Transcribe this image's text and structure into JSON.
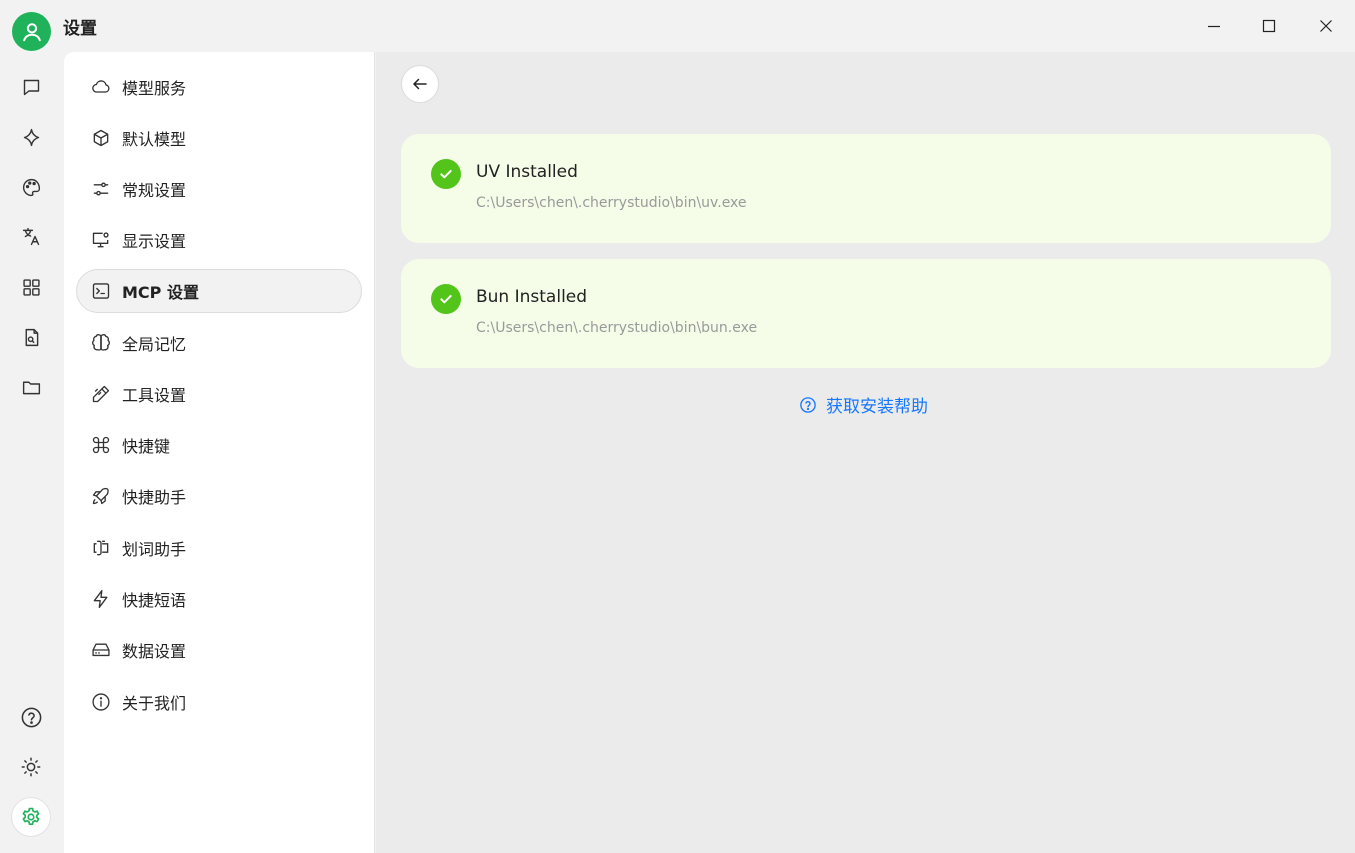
{
  "window": {
    "title": "设置",
    "controls": [
      "minimize-icon",
      "maximize-icon",
      "close-icon"
    ],
    "accent": "#1fb25a"
  },
  "rail": {
    "top": [
      "chat-bubble-icon",
      "sparkle-icon",
      "palette-icon",
      "translate-icon",
      "apps-grid-icon",
      "file-search-icon",
      "folder-icon"
    ],
    "bottom": [
      "help-circle-icon",
      "sun-icon",
      "gear-icon"
    ],
    "active": "gear-icon"
  },
  "menu": {
    "items": [
      {
        "label": "模型服务",
        "icon": "cloud-icon"
      },
      {
        "label": "默认模型",
        "icon": "cube-icon"
      },
      {
        "label": "常规设置",
        "icon": "sliders-icon"
      },
      {
        "label": "显示设置",
        "icon": "monitor-gear-icon"
      },
      {
        "label": "MCP 设置",
        "icon": "terminal-icon"
      },
      {
        "label": "全局记忆",
        "icon": "brain-icon"
      },
      {
        "label": "工具设置",
        "icon": "pencil-ruler-icon"
      },
      {
        "label": "快捷键",
        "icon": "command-icon"
      },
      {
        "label": "快捷助手",
        "icon": "rocket-icon"
      },
      {
        "label": "划词助手",
        "icon": "text-cursor-icon"
      },
      {
        "label": "快捷短语",
        "icon": "lightning-icon"
      },
      {
        "label": "数据设置",
        "icon": "hard-drive-icon"
      },
      {
        "label": "关于我们",
        "icon": "info-icon"
      }
    ],
    "active_label": "MCP 设置"
  },
  "main": {
    "cards": [
      {
        "title": "UV Installed",
        "path": "C:\\Users\\chen\\.cherrystudio\\bin\\uv.exe",
        "status": "installed"
      },
      {
        "title": "Bun Installed",
        "path": "C:\\Users\\chen\\.cherrystudio\\bin\\bun.exe",
        "status": "installed"
      }
    ],
    "help_link": "获取安装帮助",
    "colors": {
      "success": "#52c41a",
      "card_bg": "#f5fde9",
      "link": "#1677ff"
    }
  }
}
